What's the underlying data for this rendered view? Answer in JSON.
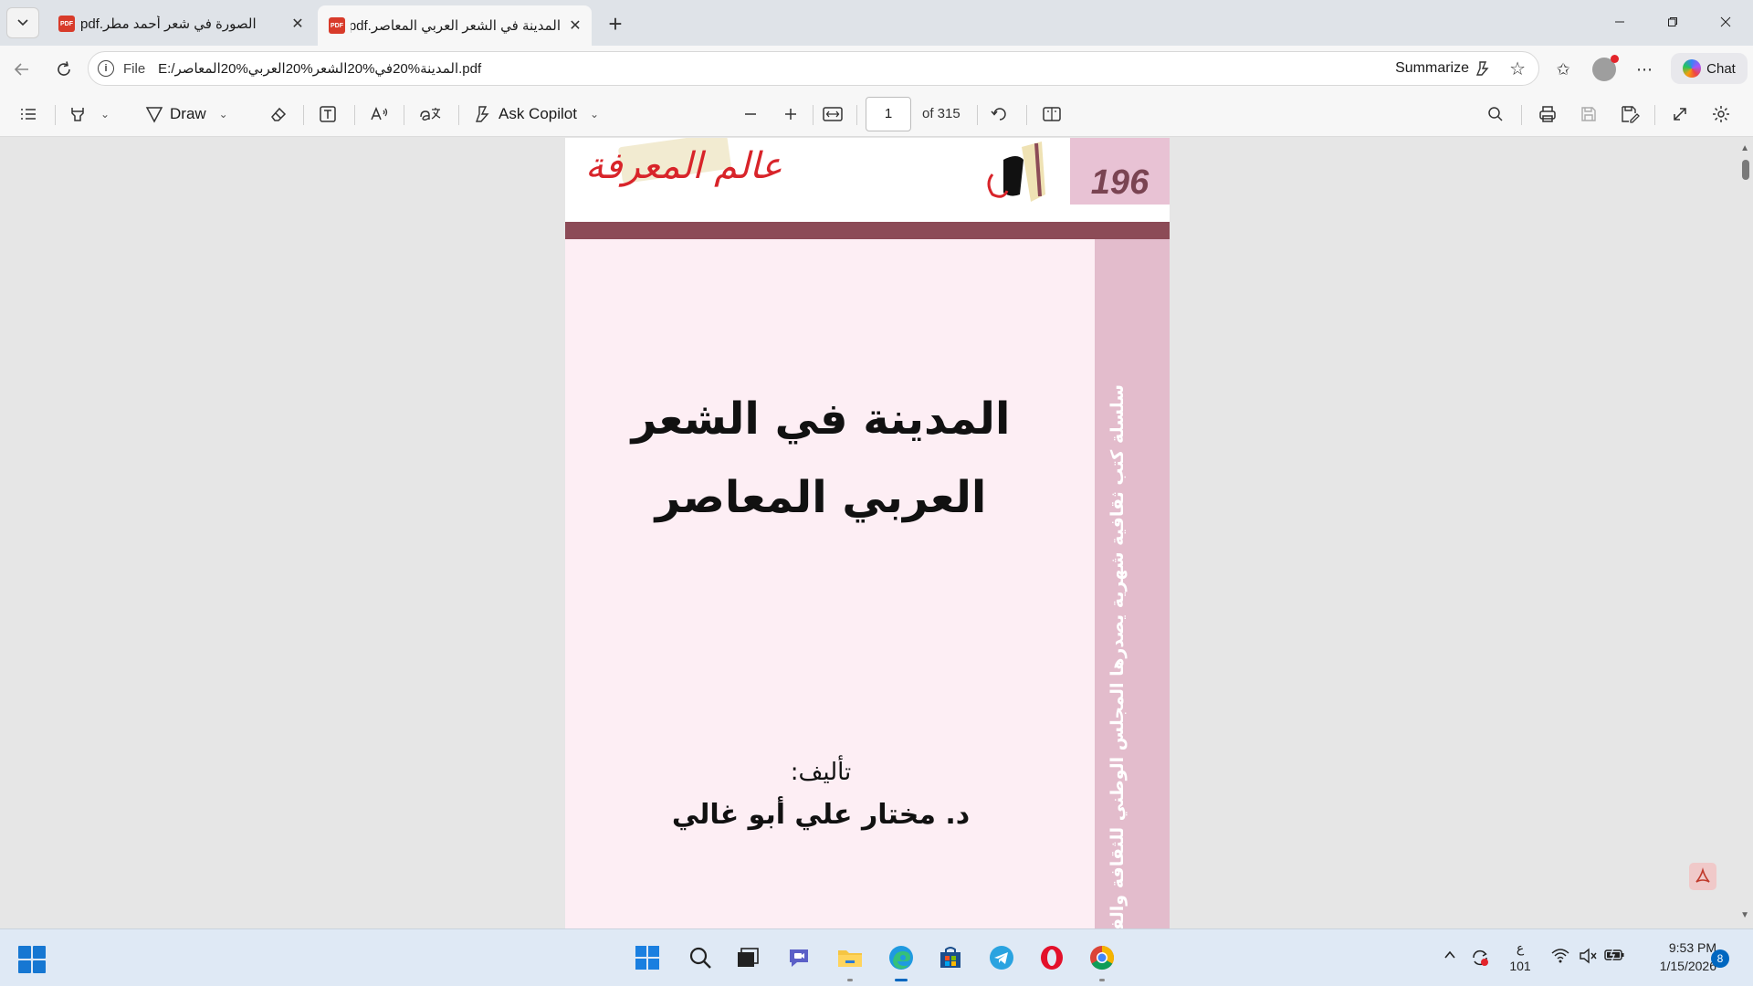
{
  "tabs": [
    {
      "title": "الصورة في شعر أحمد مطر.pdf",
      "active": false
    },
    {
      "title": "المدينة في الشعر العربي المعاصر.pdf",
      "active": true
    }
  ],
  "address": {
    "scheme": "File",
    "url": "E:/المدينة%20في%20الشعر%20العربي%20المعاصر.pdf",
    "summarize_label": "Summarize"
  },
  "chat_label": "Chat",
  "pdf_toolbar": {
    "draw_label": "Draw",
    "ask_copilot_label": "Ask Copilot",
    "page_number": "1",
    "page_count": "of 315"
  },
  "cover": {
    "issue_number": "196",
    "logo_text": "عالم المعرفة",
    "spine_text": "سلسلة كتب ثقافية شهرية يصدرها المجلس الوطني للثقافة والفنون والآداب ـ الكويت",
    "title_line1": "المدينة في الشعر",
    "title_line2": "العربي المعاصر",
    "author_label": "تأليف:",
    "author_name": "د. مختار علي أبو غالي"
  },
  "taskbar": {
    "lang_line1": "ع",
    "lang_line2": "101",
    "time": "9:53 PM",
    "date": "1/15/2026",
    "notification_count": "8"
  },
  "colors": {
    "accent": "#0067c0",
    "cover_pink": "#fdeef4",
    "spine_pink": "#e3bccc",
    "maroon": "#8c4b57",
    "logo_red": "#d8242a"
  }
}
